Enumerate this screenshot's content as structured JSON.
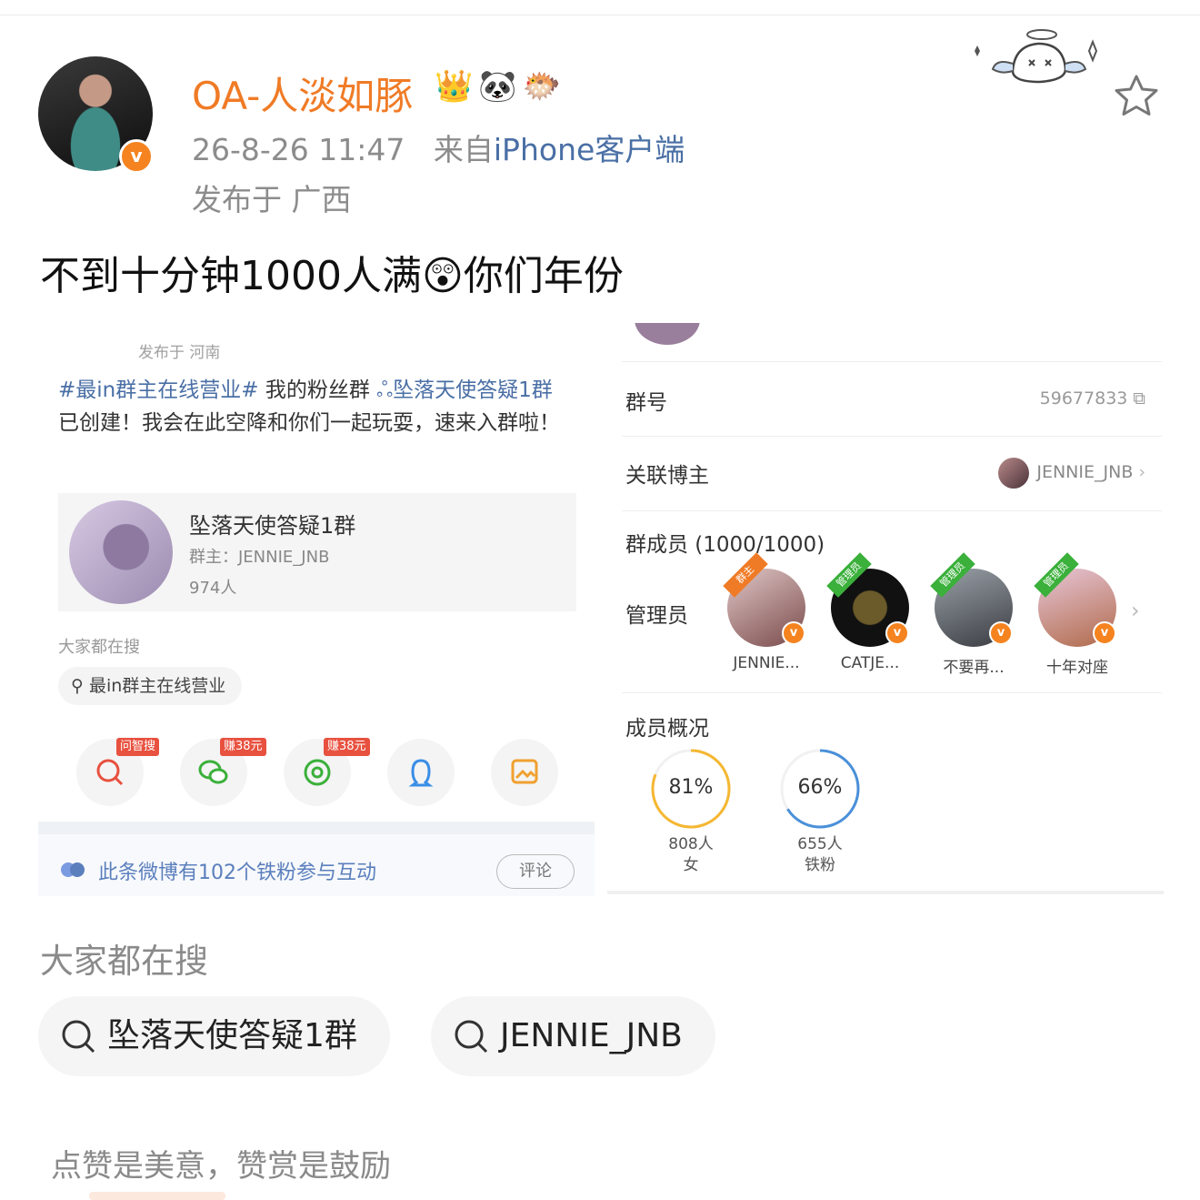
{
  "post": {
    "username": "OA-人淡如豚",
    "name_emojis": "👑🐼🐡",
    "verified_badge": "v",
    "time": "26-8-26 11:47",
    "source_prefix": "来自",
    "source_client": "iPhone客户端",
    "location": "发布于 广西",
    "text": "不到十分钟1000人满",
    "text_emoji": "😲",
    "text_suffix": "你们年份"
  },
  "left_screenshot": {
    "published": "发布于 河南",
    "hashtag": "#最in群主在线营业#",
    "text_part1": " 我的粉丝群 ",
    "group_link": "ஃ坠落天使答疑1群",
    "text_part2": " 已创建！我会在此空降和你们一起玩耍，速来入群啦！",
    "card": {
      "title": "坠落天使答疑1群",
      "owner": "群主：JENNIE_JNB",
      "count": "974人"
    },
    "hot_label": "大家都在搜",
    "hot_chip": "最in群主在线营业",
    "share_tags": [
      "问智搜",
      "赚38元",
      "赚38元"
    ],
    "fan_text": "此条微博有102个铁粉参与互动",
    "comment_button": "评论"
  },
  "right_screenshot": {
    "group_number_label": "群号",
    "group_number": "59677833",
    "blogger_label": "关联博主",
    "blogger_name": "JENNIE_JNB",
    "members_label": "群成员 (1000/1000)",
    "admins_label": "管理员",
    "admins": [
      {
        "name": "JENNIE...",
        "ribbon": "群主"
      },
      {
        "name": "CATJE...",
        "ribbon": "管理员"
      },
      {
        "name": "不要再...",
        "ribbon": "管理员"
      },
      {
        "name": "十年对座",
        "ribbon": "管理员"
      }
    ],
    "overview_label": "成员概况",
    "stats": [
      {
        "percent": "81%",
        "fraction": 0.81,
        "count": "808人",
        "label": "女",
        "color": "#f5b731"
      },
      {
        "percent": "66%",
        "fraction": 0.66,
        "count": "655人",
        "label": "铁粉",
        "color": "#4a90d9"
      }
    ]
  },
  "hot_search": {
    "title": "大家都在搜",
    "chips": [
      "坠落天使答疑1群",
      "JENNIE_JNB"
    ]
  },
  "footer": {
    "text": "点赞是美意，赞赏是鼓励"
  },
  "colors": {
    "username": "#f07b26",
    "link": "#4a6fa5",
    "verified": "#f5831f"
  }
}
